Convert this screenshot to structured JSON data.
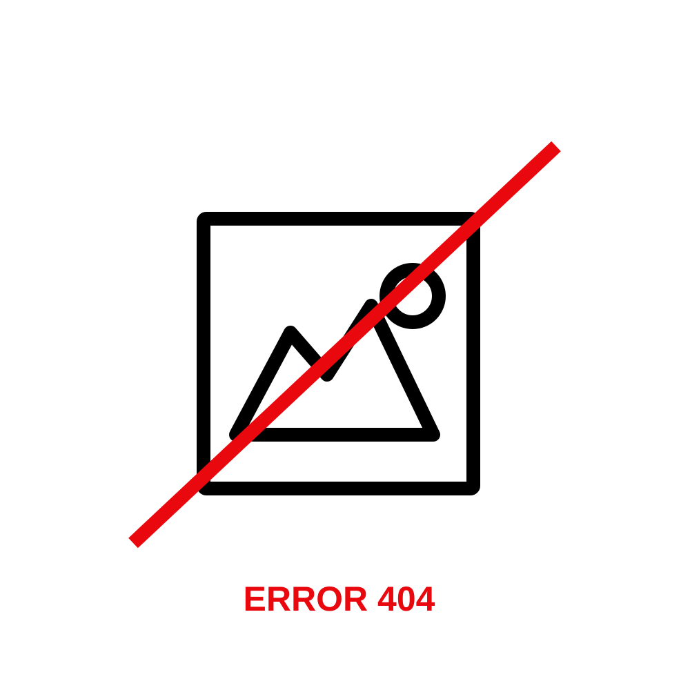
{
  "error": {
    "label": "ERROR 404"
  },
  "icons": {
    "placeholder": "broken-image-icon",
    "slash": "slash-icon"
  },
  "colors": {
    "background": "#ffffff",
    "icon_stroke": "#000000",
    "accent": "#e8080e"
  }
}
